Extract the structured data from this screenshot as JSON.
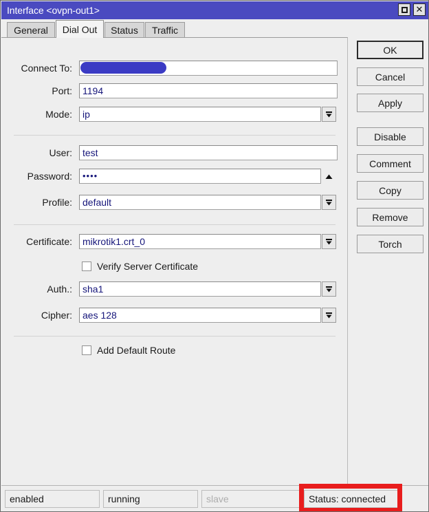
{
  "window": {
    "title": "Interface <ovpn-out1>",
    "controls": {
      "maximize": "maximize-icon",
      "close": "✕"
    }
  },
  "tabs": [
    {
      "label": "General",
      "active": false
    },
    {
      "label": "Dial Out",
      "active": true
    },
    {
      "label": "Status",
      "active": false
    },
    {
      "label": "Traffic",
      "active": false
    }
  ],
  "form": {
    "connect_to": {
      "label": "Connect To:",
      "value": "",
      "redacted": true
    },
    "port": {
      "label": "Port:",
      "value": "1194"
    },
    "mode": {
      "label": "Mode:",
      "value": "ip"
    },
    "user": {
      "label": "User:",
      "value": "test"
    },
    "password": {
      "label": "Password:",
      "value": "••••"
    },
    "profile": {
      "label": "Profile:",
      "value": "default"
    },
    "certificate": {
      "label": "Certificate:",
      "value": "mikrotik1.crt_0"
    },
    "verify_server_certificate": {
      "label": "Verify Server Certificate",
      "checked": false
    },
    "auth": {
      "label": "Auth.:",
      "value": "sha1"
    },
    "cipher": {
      "label": "Cipher:",
      "value": "aes 128"
    },
    "add_default_route": {
      "label": "Add Default Route",
      "checked": false
    }
  },
  "buttons": [
    {
      "label": "OK",
      "focused": true
    },
    {
      "label": "Cancel",
      "focused": false
    },
    {
      "label": "Apply",
      "focused": false
    },
    {
      "label": "Disable",
      "focused": false
    },
    {
      "label": "Comment",
      "focused": false
    },
    {
      "label": "Copy",
      "focused": false
    },
    {
      "label": "Remove",
      "focused": false
    },
    {
      "label": "Torch",
      "focused": false
    }
  ],
  "statusbar": {
    "enabled": "enabled",
    "running": "running",
    "slave": "slave",
    "status": "Status: connected"
  },
  "colors": {
    "titlebar": "#4a4ac0",
    "redaction": "#3b3bc4",
    "highlight_box": "#e81d1d",
    "field_text": "#15157a",
    "panel": "#eeeeee"
  }
}
